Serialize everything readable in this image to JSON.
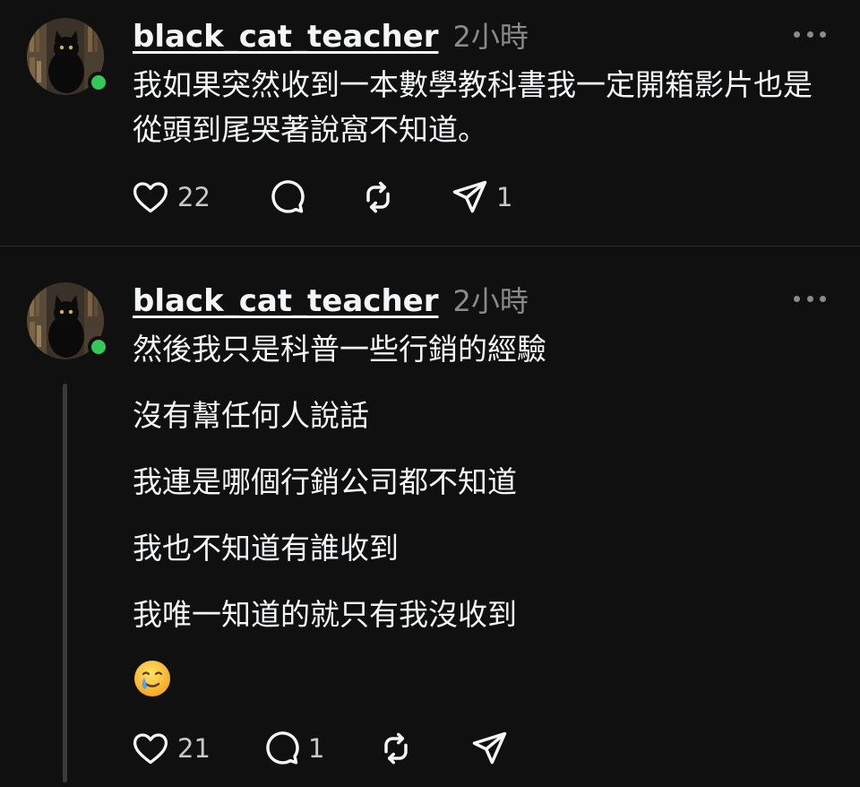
{
  "posts": [
    {
      "username": "black_cat_teacher",
      "timestamp": "2小時",
      "paragraphs": [
        "我如果突然收到一本數學教科書我一定開箱影片也是從頭到尾哭著說窩不知道。"
      ],
      "likes": "22",
      "comments": "",
      "reposts": "",
      "shares": "1"
    },
    {
      "username": "black_cat_teacher",
      "timestamp": "2小時",
      "paragraphs": [
        "然後我只是科普一些行銷的經驗",
        "沒有幫任何人說話",
        "我連是哪個行銷公司都不知道",
        "我也不知道有誰收到",
        "我唯一知道的就只有我沒收到"
      ],
      "emoji": "smiling-face-with-tear",
      "likes": "21",
      "comments": "1",
      "reposts": "",
      "shares": ""
    }
  ],
  "colors": {
    "background": "#101010",
    "text": "#f3f5f7",
    "muted": "#8a8a8a",
    "online": "#35c759"
  },
  "icons": [
    "heart-icon",
    "comment-icon",
    "repost-icon",
    "share-icon",
    "more-icon"
  ]
}
